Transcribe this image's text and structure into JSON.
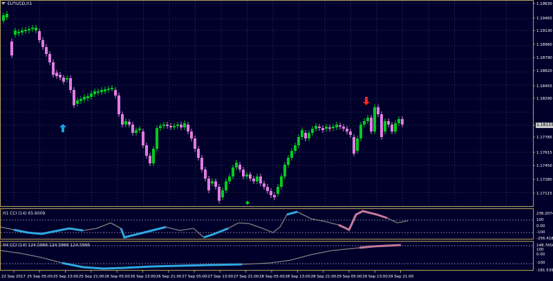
{
  "chart_window": {
    "symbol_title": "EURUSD,H1",
    "current_price": "1.18133",
    "colors": {
      "background": "#00002a",
      "frame": "#b8a15a",
      "bull_candle": "#00cc1e",
      "bear_candle": "#e07ce0",
      "cci_line": "#808080",
      "cci_low": "#2fa8e0",
      "cci_high": "#c47a9a",
      "buy_arrow": "#1e9fe8",
      "sell_arrow": "#ff2020"
    },
    "price_scale": [
      "1.19630",
      "1.19465",
      "1.19130",
      "1.18960",
      "1.18790",
      "1.18620",
      "1.18455",
      "1.18290",
      "1.17950",
      "1.17785",
      "1.17615",
      "1.17450",
      "1.17280",
      "1.17115"
    ],
    "time_axis": [
      "22 Sep 2017",
      "25 Sep 05:00",
      "25 Sep 13:00",
      "25 Sep 21:00",
      "26 Sep 05:00",
      "26 Sep 13:00",
      "26 Sep 21:00",
      "27 Sep 05:00",
      "27 Sep 13:00",
      "27 Sep 21:00",
      "28 Sep 05:00",
      "28 Sep 13:00",
      "28 Sep 21:00",
      "29 Sep 05:00",
      "29 Sep 13:00",
      "29 Sep 21:00"
    ],
    "markers": {
      "buy": "up-arrow",
      "sell": "down-arrow",
      "signal": "green-diamond"
    }
  },
  "cci_h1": {
    "label": "H1 CCI (14) 65.6009",
    "scale": [
      "236.2074",
      "100",
      "0.00",
      "-100",
      "-256.418"
    ]
  },
  "cci_h4": {
    "label": "H4 CCI (14) 124.5966 124.5966 124.5966",
    "scale": [
      "148.7656",
      "100",
      "0.00",
      "-100",
      "-181.535"
    ]
  }
}
